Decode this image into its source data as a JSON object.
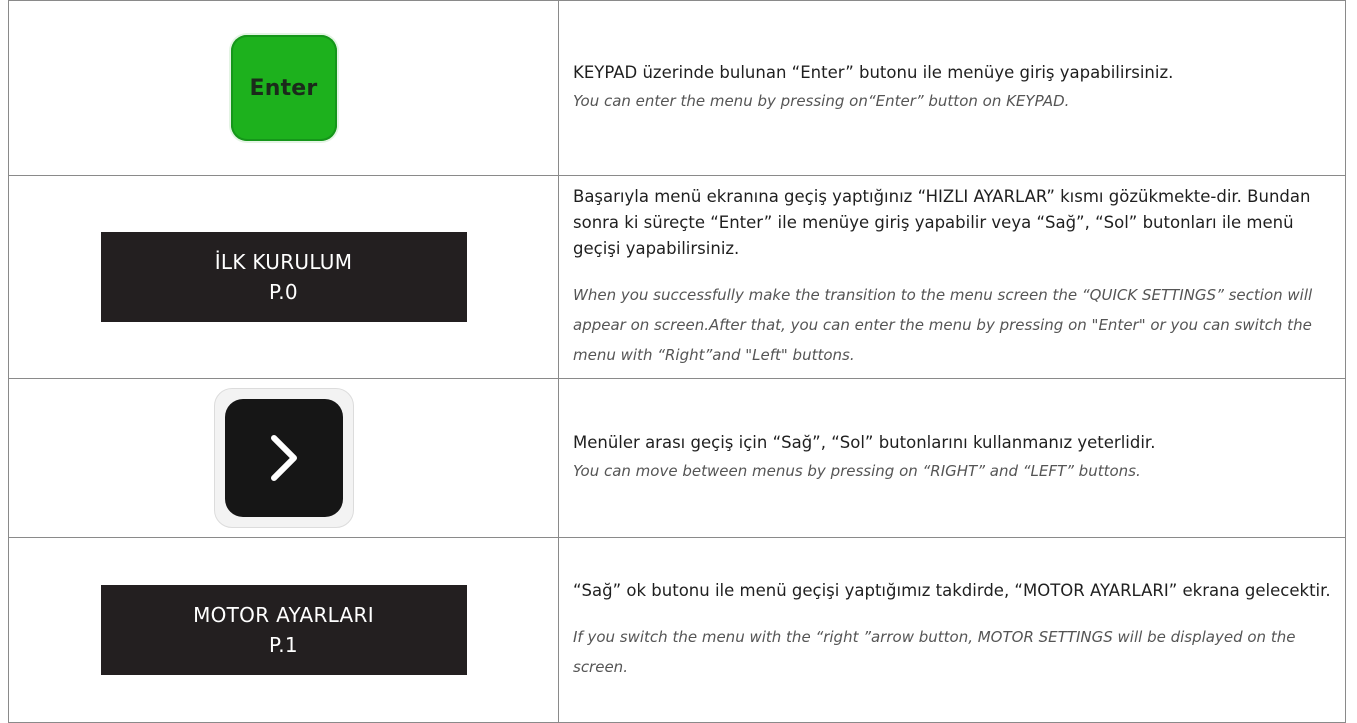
{
  "rows": [
    {
      "visual": {
        "type": "key",
        "label": "Enter",
        "color": "#1db11d"
      },
      "tr": "KEYPAD üzerinde bulunan “Enter” butonu ile menüye giriş yapabilirsiniz.",
      "en": "You can enter the menu by pressing on“Enter”  button on KEYPAD."
    },
    {
      "visual": {
        "type": "screen",
        "line1": "İLK KURULUM",
        "line2": "P.0"
      },
      "tr": "Başarıyla menü ekranına geçiş yaptığınız “HIZLI AYARLAR” kısmı gözükmekte-dir. Bundan sonra ki süreçte “Enter” ile menüye giriş yapabilir veya “Sağ”, “Sol” butonları ile menü geçişi yapabilirsiniz.",
      "en": "When you successfully make the transition to the menu screen the “QUICK SETTINGS” section will appear on screen.After that, you can enter the menu by pressing on \"Enter\" or you can switch the menu with “Right”and \"Left\" buttons."
    },
    {
      "visual": {
        "type": "arrow-key",
        "icon": "chevron-right-icon"
      },
      "tr": "Menüler arası geçiş için “Sağ”, “Sol” butonlarını kullanmanız yeterlidir.",
      "en": "You can move between menus by pressing on “RIGHT” and “LEFT” buttons."
    },
    {
      "visual": {
        "type": "screen",
        "line1": "MOTOR AYARLARI",
        "line2": "P.1"
      },
      "tr": "“Sağ” ok butonu ile menü geçişi yaptığımız takdirde, “MOTOR AYARLARI” ekrana gelecektir.",
      "en": "If you switch the menu with the “right ”arrow button, MOTOR SETTINGS  will be displayed on the screen."
    }
  ],
  "colors": {
    "screen_bg": "#231f20",
    "enter_key": "#1db11d",
    "arrow_key": "#161616",
    "border": "#8a8a8a"
  }
}
